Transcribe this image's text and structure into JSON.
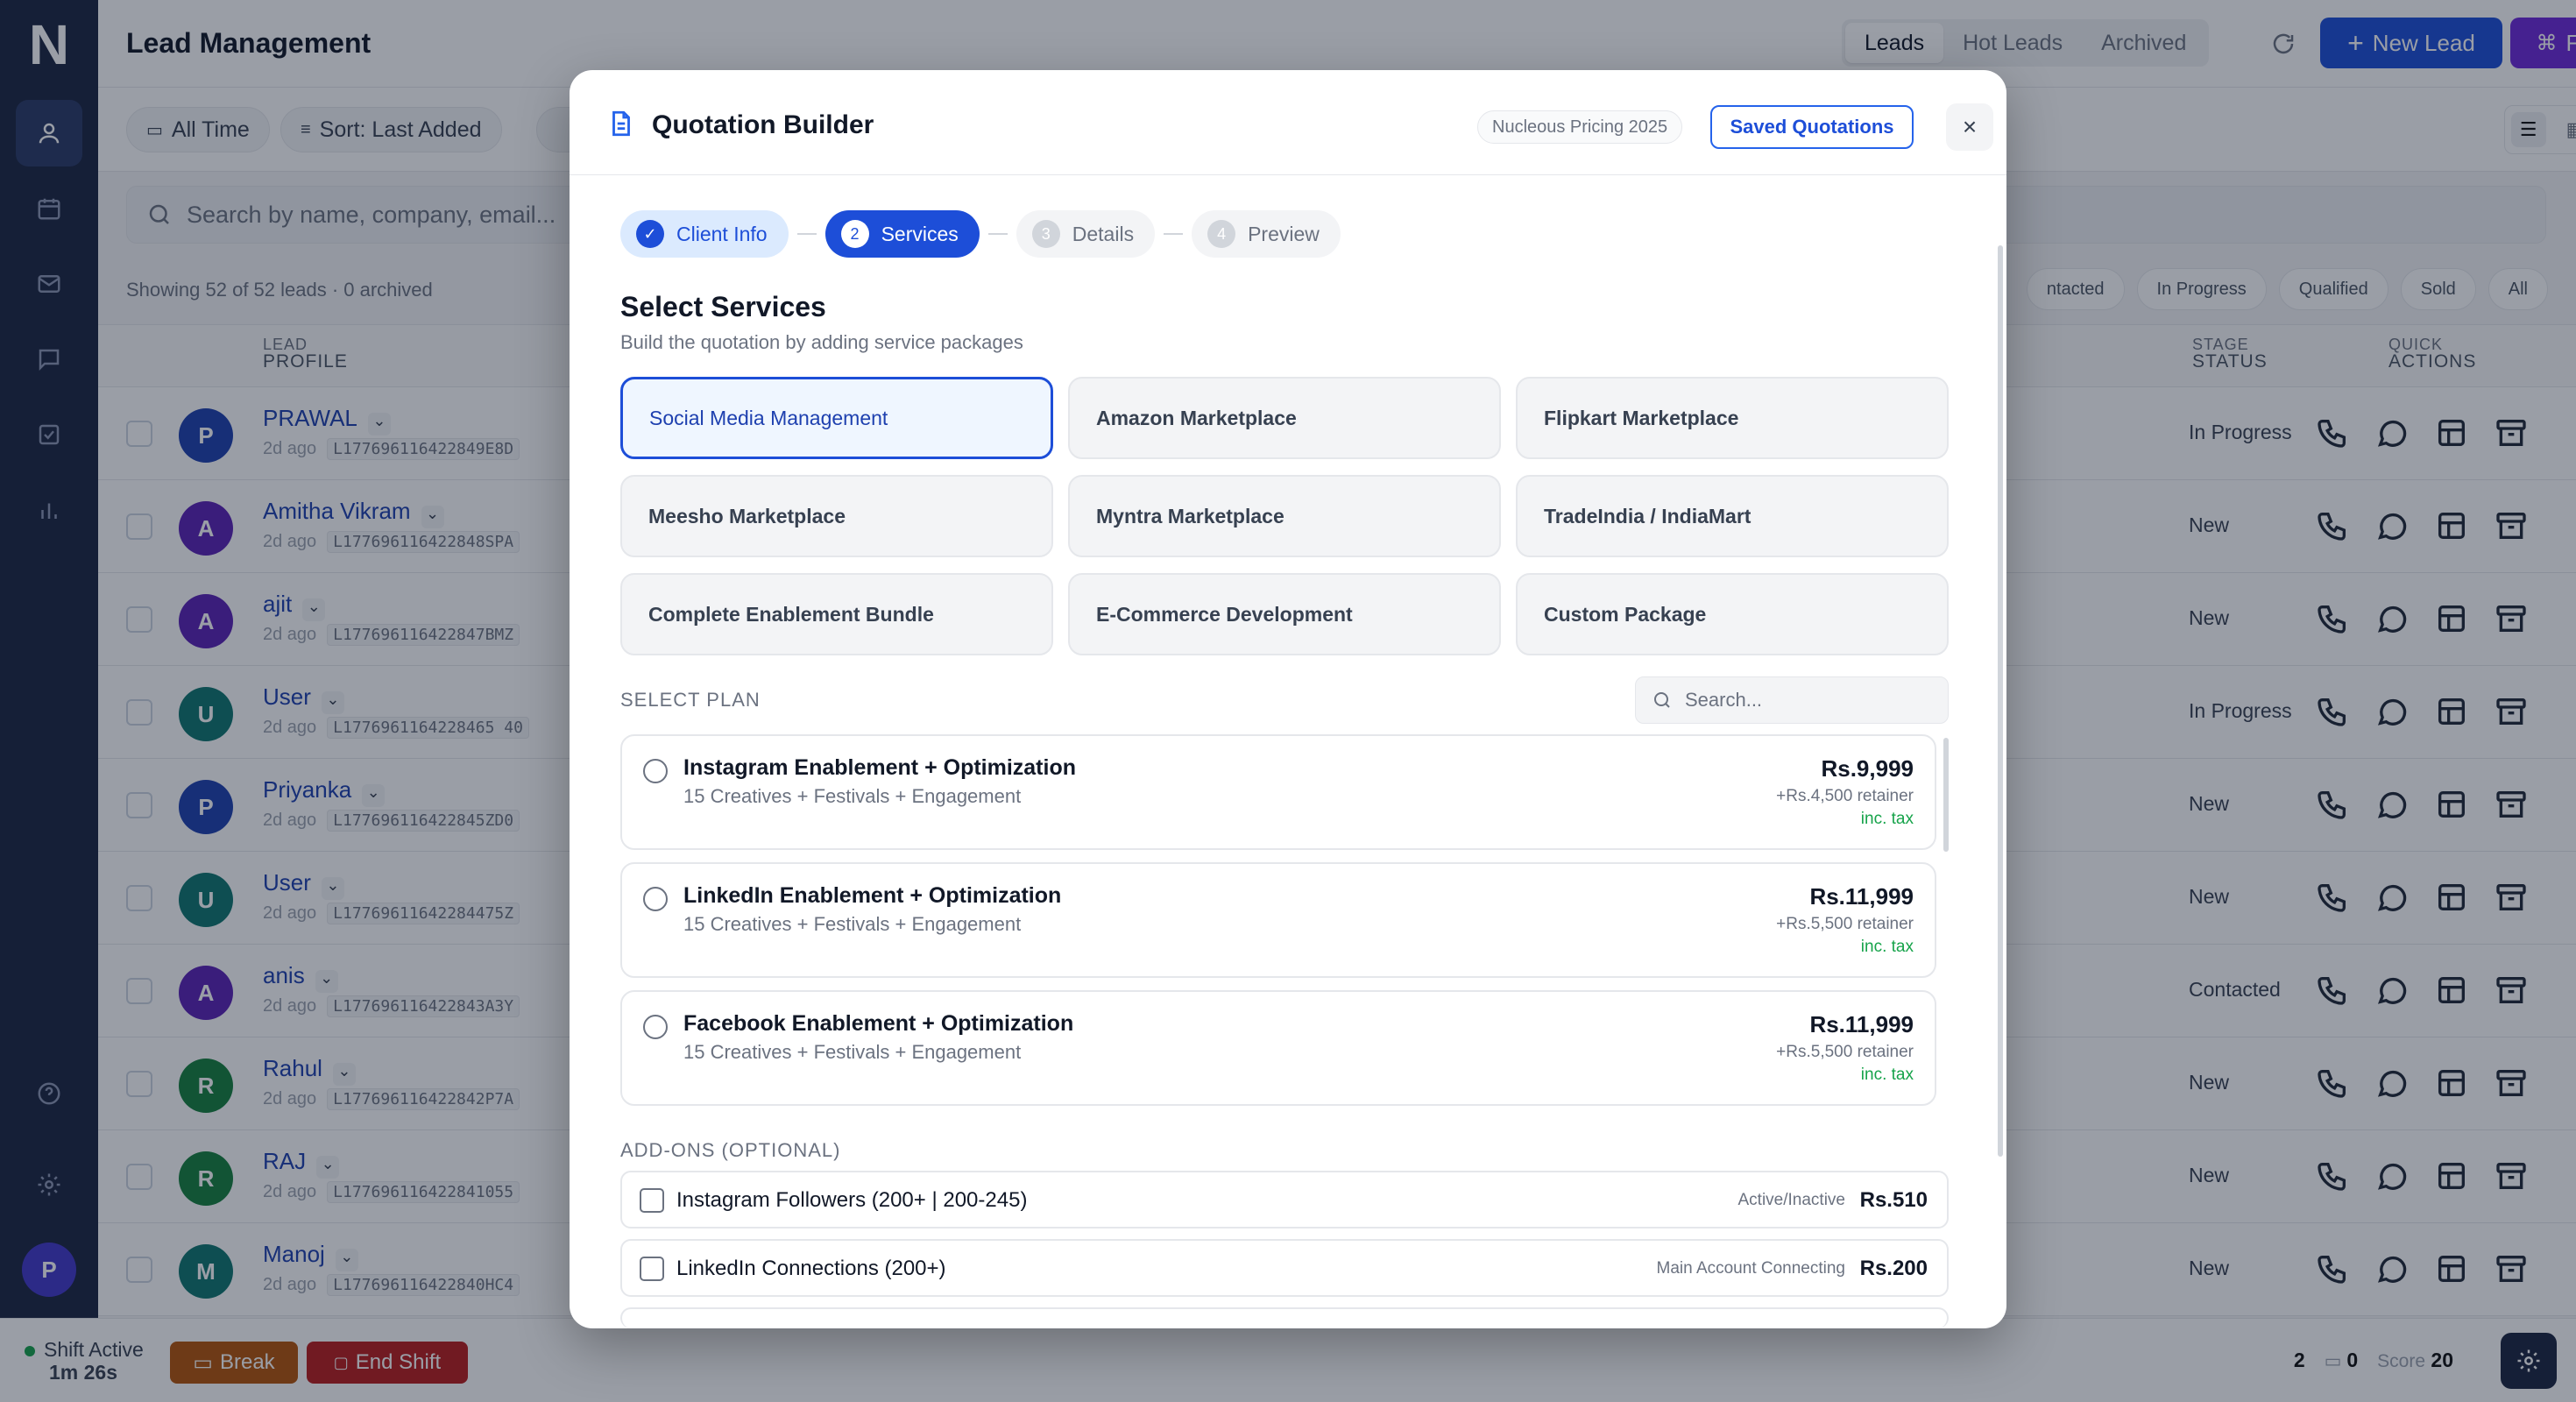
{
  "app": {
    "logo_letter": "N",
    "page_title": "Lead Management"
  },
  "sidebar": {
    "avatar_initial": "P"
  },
  "top_tabs": [
    "Leads",
    "Hot Leads",
    "Archived"
  ],
  "actions": {
    "new_lead": "New Lead",
    "flow": "Flow"
  },
  "filters": {
    "time": "All Time",
    "sort": "Sort: Last Added"
  },
  "search": {
    "placeholder": "Search by name, company, email..."
  },
  "summary": "Showing 52 of 52 leads · 0 archived",
  "status_pills": [
    "ntacted",
    "In Progress",
    "Qualified",
    "Sold",
    "All"
  ],
  "table": {
    "headers": {
      "lead_small": "LEAD",
      "lead": "PROFILE",
      "stage_small": "STAGE",
      "stage": "STATUS",
      "quick_small": "QUICK",
      "quick": "ACTIONS"
    },
    "rows": [
      {
        "initial": "P",
        "name": "PRAWAL",
        "time": "2d ago",
        "id": "L177696116422849E8D",
        "status": "In Progress",
        "color": "#1e40af"
      },
      {
        "initial": "A",
        "name": "Amitha Vikram",
        "time": "2d ago",
        "id": "L177696116422848SPA",
        "status": "New",
        "color": "#5b21b6"
      },
      {
        "initial": "A",
        "name": "ajit",
        "time": "2d ago",
        "id": "L177696116422847BMZ",
        "status": "New",
        "color": "#5b21b6"
      },
      {
        "initial": "U",
        "name": "User",
        "time": "2d ago",
        "id": "L1776961164228465 40",
        "status": "In Progress",
        "color": "#0f766e"
      },
      {
        "initial": "P",
        "name": "Priyanka",
        "time": "2d ago",
        "id": "L177696116422845ZD0",
        "status": "New",
        "color": "#1e40af"
      },
      {
        "initial": "U",
        "name": "User",
        "time": "2d ago",
        "id": "L17769611642284475Z",
        "status": "New",
        "color": "#0f766e"
      },
      {
        "initial": "A",
        "name": "anis",
        "time": "2d ago",
        "id": "L177696116422843A3Y",
        "status": "Contacted",
        "color": "#5b21b6"
      },
      {
        "initial": "R",
        "name": "Rahul",
        "time": "2d ago",
        "id": "L177696116422842P7A",
        "status": "New",
        "color": "#15803d"
      },
      {
        "initial": "R",
        "name": "RAJ",
        "time": "2d ago",
        "id": "L177696116422841055",
        "status": "New",
        "color": "#15803d"
      },
      {
        "initial": "M",
        "name": "Manoj",
        "time": "2d ago",
        "id": "L177696116422840HC4",
        "status": "New",
        "color": "#0f766e"
      }
    ]
  },
  "footer": {
    "shift_label": "Shift Active",
    "shift_time": "1m 26s",
    "break": "Break",
    "end_shift": "End Shift",
    "stat1": "2",
    "stat2": "0",
    "score_label": "Score",
    "score": "20"
  },
  "modal": {
    "title": "Quotation Builder",
    "pricing_tag": "Nucleous Pricing 2025",
    "saved_btn": "Saved Quotations",
    "close": "×",
    "steps": [
      {
        "n": "✓",
        "label": "Client Info",
        "state": "done"
      },
      {
        "n": "2",
        "label": "Services",
        "state": "cur"
      },
      {
        "n": "3",
        "label": "Details",
        "state": "todo"
      },
      {
        "n": "4",
        "label": "Preview",
        "state": "todo"
      }
    ],
    "section_title": "Select Services",
    "section_sub": "Build the quotation by adding service packages",
    "services": [
      "Social Media Management",
      "Amazon Marketplace",
      "Flipkart Marketplace",
      "Meesho Marketplace",
      "Myntra Marketplace",
      "TradeIndia / IndiaMart",
      "Complete Enablement Bundle",
      "E-Commerce Development",
      "Custom Package"
    ],
    "selected_service": 0,
    "plan_label": "SELECT PLAN",
    "plan_search_placeholder": "Search...",
    "plans": [
      {
        "name": "Instagram Enablement + Optimization",
        "desc": "15 Creatives + Festivals + Engagement",
        "price": "Rs.9,999",
        "retainer": "+Rs.4,500 retainer",
        "tax": "inc. tax"
      },
      {
        "name": "LinkedIn Enablement + Optimization",
        "desc": "15 Creatives + Festivals + Engagement",
        "price": "Rs.11,999",
        "retainer": "+Rs.5,500 retainer",
        "tax": "inc. tax"
      },
      {
        "name": "Facebook Enablement + Optimization",
        "desc": "15 Creatives + Festivals + Engagement",
        "price": "Rs.11,999",
        "retainer": "+Rs.5,500 retainer",
        "tax": "inc. tax"
      }
    ],
    "addons_label": "ADD-ONS (OPTIONAL)",
    "addons": [
      {
        "name": "Instagram Followers (200+ | 200-245)",
        "tag": "Active/Inactive",
        "price": "Rs.510"
      },
      {
        "name": "LinkedIn Connections (200+)",
        "tag": "Main Account Connecting",
        "price": "Rs.200"
      }
    ]
  }
}
